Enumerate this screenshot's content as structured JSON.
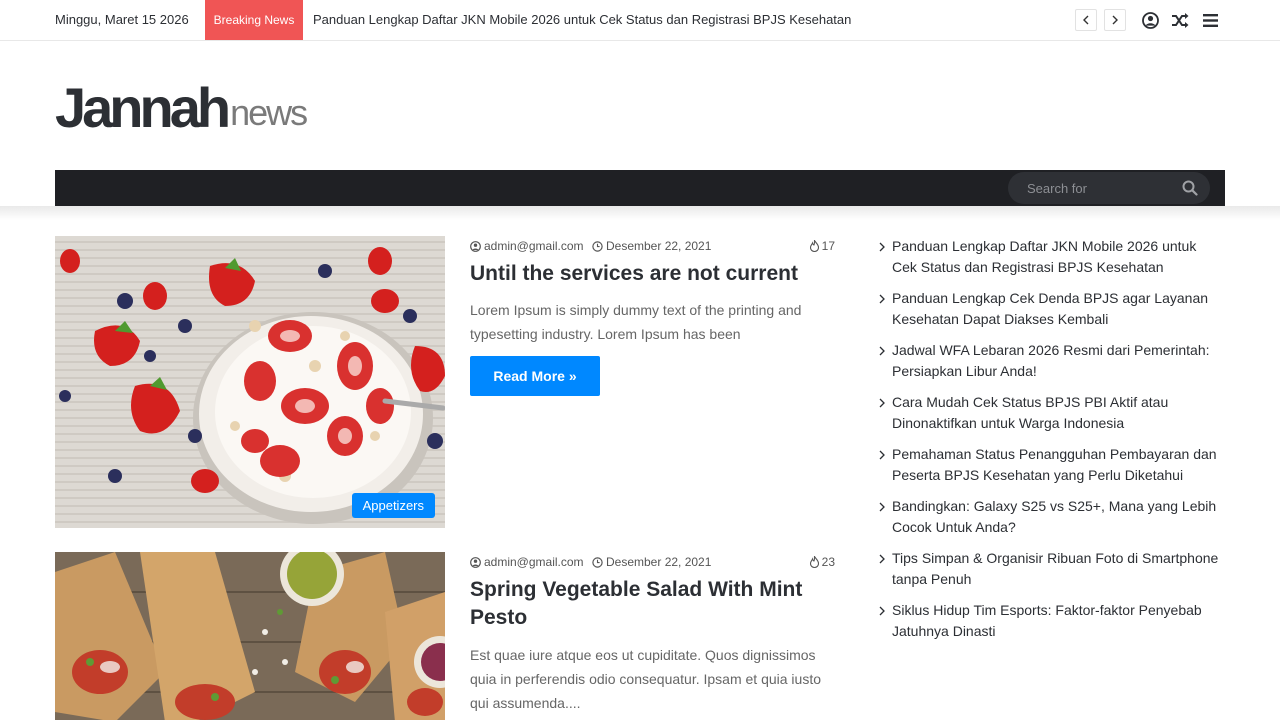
{
  "topbar": {
    "date": "Minggu, Maret 15 2026",
    "breaking_label": "Breaking News",
    "ticker_text": "Panduan Lengkap Daftar JKN Mobile 2026 untuk Cek Status dan Registrasi BPJS Kesehatan",
    "icons": [
      "chevron-left-icon",
      "chevron-right-icon",
      "user-icon",
      "shuffle-icon",
      "menu-icon"
    ]
  },
  "logo": {
    "main": "Jannah",
    "sub": "news"
  },
  "nav": {
    "search_placeholder": "Search for"
  },
  "colors": {
    "accent": "#0088ff",
    "breaking": "#f05555",
    "nav_bg": "#1f2024",
    "text": "#2c2f34"
  },
  "posts": [
    {
      "author": "admin@gmail.com",
      "date": "Desember 22, 2021",
      "views": "17",
      "title": "Until the services are not current",
      "excerpt": "Lorem Ipsum is simply dummy text of the printing and typesetting industry. Lorem Ipsum has been",
      "read_more": "Read More »",
      "category": "Appetizers"
    },
    {
      "author": "admin@gmail.com",
      "date": "Desember 22, 2021",
      "views": "23",
      "title": "Spring Vegetable Salad With Mint Pesto",
      "excerpt": "Est quae iure atque eos ut cupiditate. Quos dignissimos quia in perferendis odio consequatur. Ipsam et quia iusto qui assumenda...."
    }
  ],
  "sidebar": {
    "items": [
      "Panduan Lengkap Daftar JKN Mobile 2026 untuk Cek Status dan Registrasi BPJS Kesehatan",
      "Panduan Lengkap Cek Denda BPJS agar Layanan Kesehatan Dapat Diakses Kembali",
      "Jadwal WFA Lebaran 2026 Resmi dari Pemerintah: Persiapkan Libur Anda!",
      "Cara Mudah Cek Status BPJS PBI Aktif atau Dinonaktifkan untuk Warga Indonesia",
      "Pemahaman Status Penangguhan Pembayaran dan Peserta BPJS Kesehatan yang Perlu Diketahui",
      "Bandingkan: Galaxy S25 vs S25+, Mana yang Lebih Cocok Untuk Anda?",
      "Tips Simpan & Organisir Ribuan Foto di Smartphone tanpa Penuh",
      "Siklus Hidup Tim Esports: Faktor-faktor Penyebab Jatuhnya Dinasti"
    ]
  }
}
